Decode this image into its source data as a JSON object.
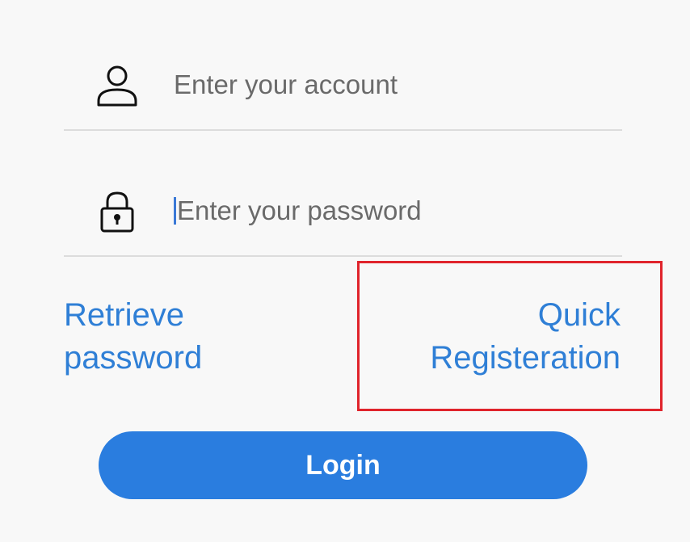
{
  "form": {
    "account": {
      "placeholder": "Enter your account",
      "value": "",
      "icon": "user-icon"
    },
    "password": {
      "placeholder": "Enter your password",
      "value": "",
      "icon": "lock-icon"
    }
  },
  "links": {
    "retrieve_line1": "Retrieve",
    "retrieve_line2": "password",
    "register_line1": "Quick",
    "register_line2": "Registeration"
  },
  "login_button": {
    "label": "Login"
  },
  "colors": {
    "accent": "#2a7ddf",
    "link": "#2f7fd6",
    "highlight": "#e0242c",
    "background": "#f8f8f8"
  }
}
